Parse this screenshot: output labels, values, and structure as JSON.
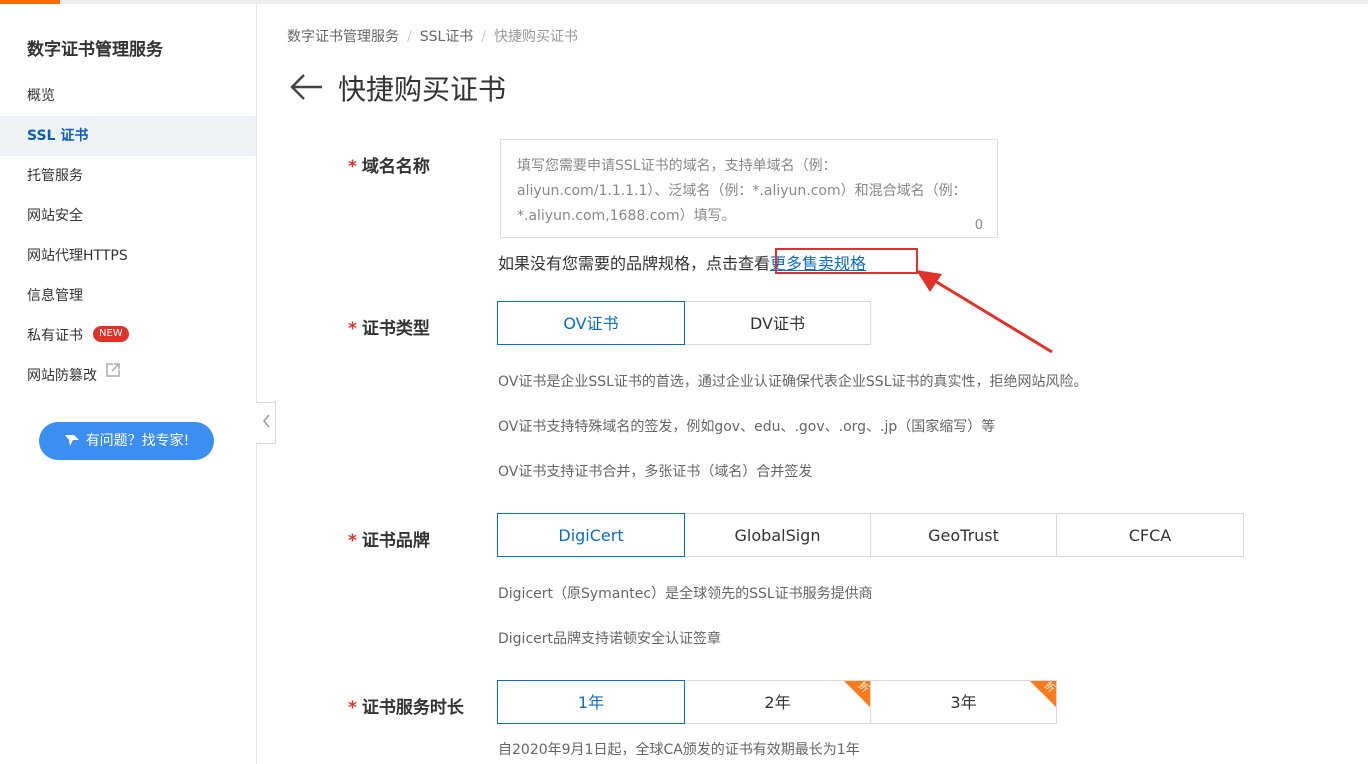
{
  "sidebar": {
    "title": "数字证书管理服务",
    "items": [
      {
        "label": "概览"
      },
      {
        "label": "SSL 证书"
      },
      {
        "label": "托管服务"
      },
      {
        "label": "网站安全"
      },
      {
        "label": "网站代理HTTPS"
      },
      {
        "label": "信息管理"
      },
      {
        "label": "私有证书",
        "badge": "NEW"
      },
      {
        "label": "网站防篡改"
      }
    ],
    "help_button": "有问题？找专家!"
  },
  "breadcrumb": [
    "数字证书管理服务",
    "SSL证书",
    "快捷购买证书"
  ],
  "breadcrumb_sep": "/",
  "page_title": "快捷购买证书",
  "form": {
    "domain": {
      "required_mark": "*",
      "label": "域名名称",
      "placeholder": "填写您需要申请SSL证书的域名，支持单域名（例：aliyun.com/1.1.1.1）、泛域名（例：*.aliyun.com）和混合域名（例：*.aliyun.com,1688.com）填写。",
      "value": "",
      "char_count": "0"
    },
    "hint_text": "如果没有您需要的品牌规格，点击查看",
    "hint_link": "更多售卖规格",
    "cert_type": {
      "required_mark": "*",
      "label": "证书类型",
      "options": [
        "OV证书",
        "DV证书"
      ],
      "selected": "OV证书",
      "descriptions": [
        "OV证书是企业SSL证书的首选，通过企业认证确保代表企业SSL证书的真实性，拒绝网站风险。",
        "OV证书支持特殊域名的签发，例如gov、edu、.gov、.org、.jp（国家缩写）等",
        "OV证书支持证书合并，多张证书（域名）合并签发"
      ]
    },
    "cert_brand": {
      "required_mark": "*",
      "label": "证书品牌",
      "options": [
        "DigiCert",
        "GlobalSign",
        "GeoTrust",
        "CFCA"
      ],
      "selected": "DigiCert",
      "descriptions": [
        "Digicert（原Symantec）是全球领先的SSL证书服务提供商",
        "Digicert品牌支持诺顿安全认证签章"
      ]
    },
    "duration": {
      "required_mark": "*",
      "label": "证书服务时长",
      "options": [
        {
          "label": "1年",
          "tag": ""
        },
        {
          "label": "2年",
          "tag": "折"
        },
        {
          "label": "3年",
          "tag": "折"
        }
      ],
      "selected": "1年",
      "note": "自2020年9月1日起，全球CA颁发的证书有效期最长为1年"
    }
  },
  "colors": {
    "accent_blue": "#0a6cc2",
    "required_red": "#e0322b",
    "brand_orange": "#ff6a00",
    "help_button_blue": "#3c8ef0",
    "discount_tag_orange": "#ff7a1a"
  },
  "icons": {
    "back": "arrow-left-icon",
    "collapse": "chevron-left-icon",
    "external": "external-link-icon",
    "help": "bird-icon"
  }
}
